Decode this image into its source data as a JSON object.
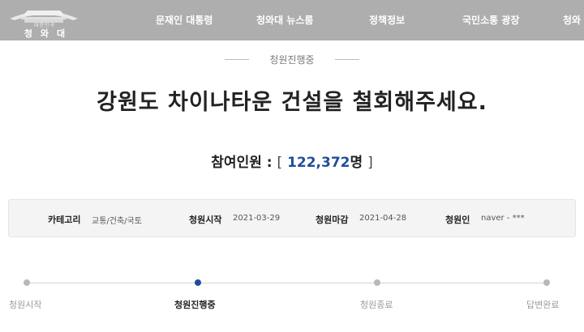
{
  "header": {
    "logo": {
      "subtitle": "대한민국",
      "name": "청와대"
    },
    "nav": [
      "문재인 대통령",
      "청와대 뉴스룸",
      "정책정보",
      "국민소통 광장",
      "청와"
    ]
  },
  "petition": {
    "status": "청원진행중",
    "title": "강원도 차이나타운 건설을 철회해주세요.",
    "participants": {
      "label": "참여인원 :",
      "open_bracket": "[",
      "count": "122,372",
      "unit": "명",
      "close_bracket": "]"
    },
    "info": {
      "category_label": "카테고리",
      "category": "교통/건축/국토",
      "start_label": "청원시작",
      "start": "2021-03-29",
      "end_label": "청원마감",
      "end": "2021-04-28",
      "author_label": "청원인",
      "author": "naver - ***"
    },
    "progress": {
      "steps": [
        "청원시작",
        "청원진행중",
        "청원종료",
        "답변완료"
      ],
      "current_step": "청원진행중",
      "active_color": "#1f4f9a"
    }
  },
  "colors": {
    "topbar": "#aeaeae",
    "accent": "#1f4f9a"
  }
}
